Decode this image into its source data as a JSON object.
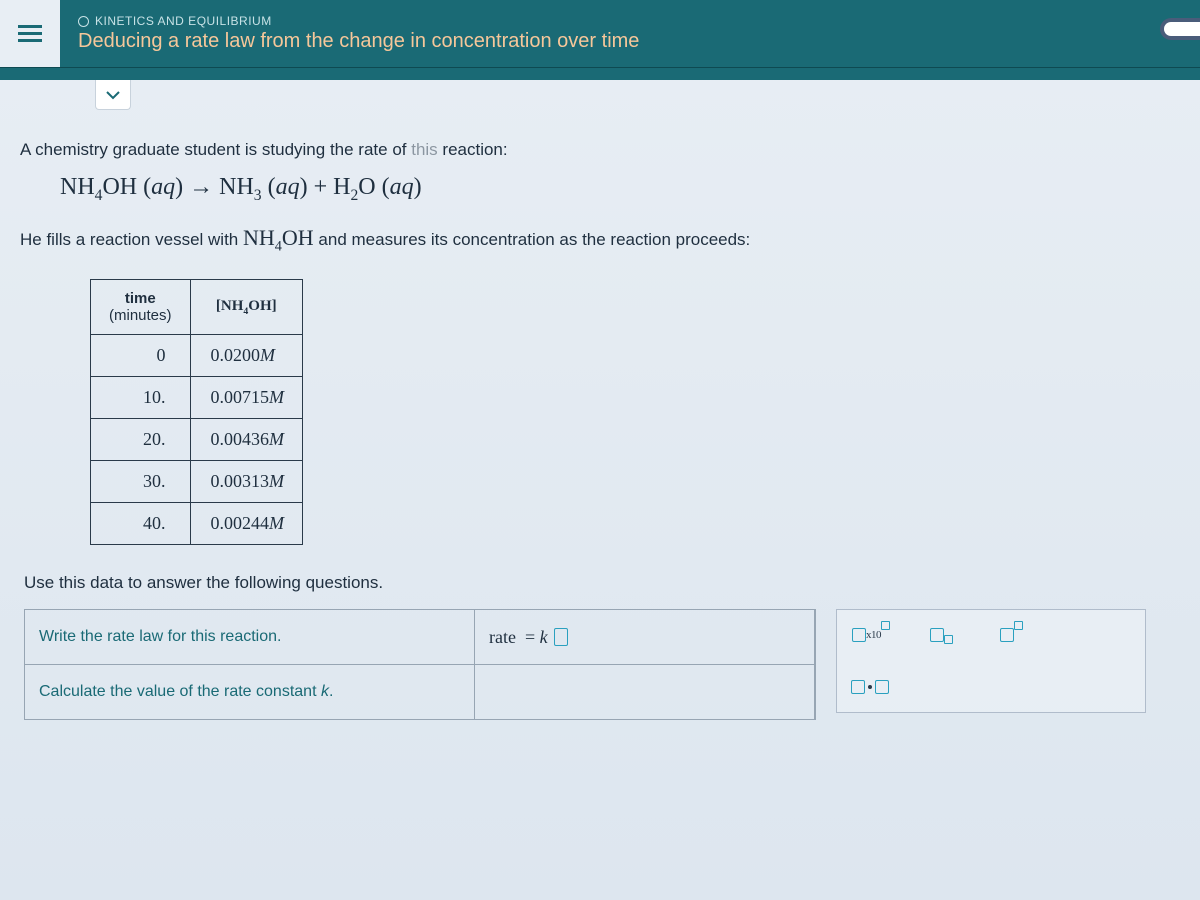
{
  "header": {
    "breadcrumb": "KINETICS AND EQUILIBRIUM",
    "title": "Deducing a rate law from the change in concentration over time"
  },
  "problem": {
    "intro_prefix": "A chemistry graduate student is studying the rate of ",
    "intro_suffix": " reaction:",
    "intro_gap": "this",
    "equation_plain": "NH4OH (aq) → NH3 (aq) + H2O (aq)",
    "fill_prefix": "He fills a reaction vessel with ",
    "species": "NH4OH",
    "fill_suffix": " and measures its concentration as the reaction proceeds:",
    "followup": "Use this data to answer the following questions."
  },
  "table": {
    "col1_line1": "time",
    "col1_line2": "(minutes)",
    "col2": "[NH4OH]",
    "rows": [
      {
        "t": "0",
        "c": "0.0200 M"
      },
      {
        "t": "10.",
        "c": "0.00715 M"
      },
      {
        "t": "20.",
        "c": "0.00436 M"
      },
      {
        "t": "30.",
        "c": "0.00313 M"
      },
      {
        "t": "40.",
        "c": "0.00244 M"
      }
    ]
  },
  "questions": {
    "q1_prompt": "Write the rate law for this reaction.",
    "q1_answer_prefix": "rate  = k",
    "q2_prompt": "Calculate the value of the rate constant k."
  },
  "tools": {
    "x10": "x10"
  }
}
